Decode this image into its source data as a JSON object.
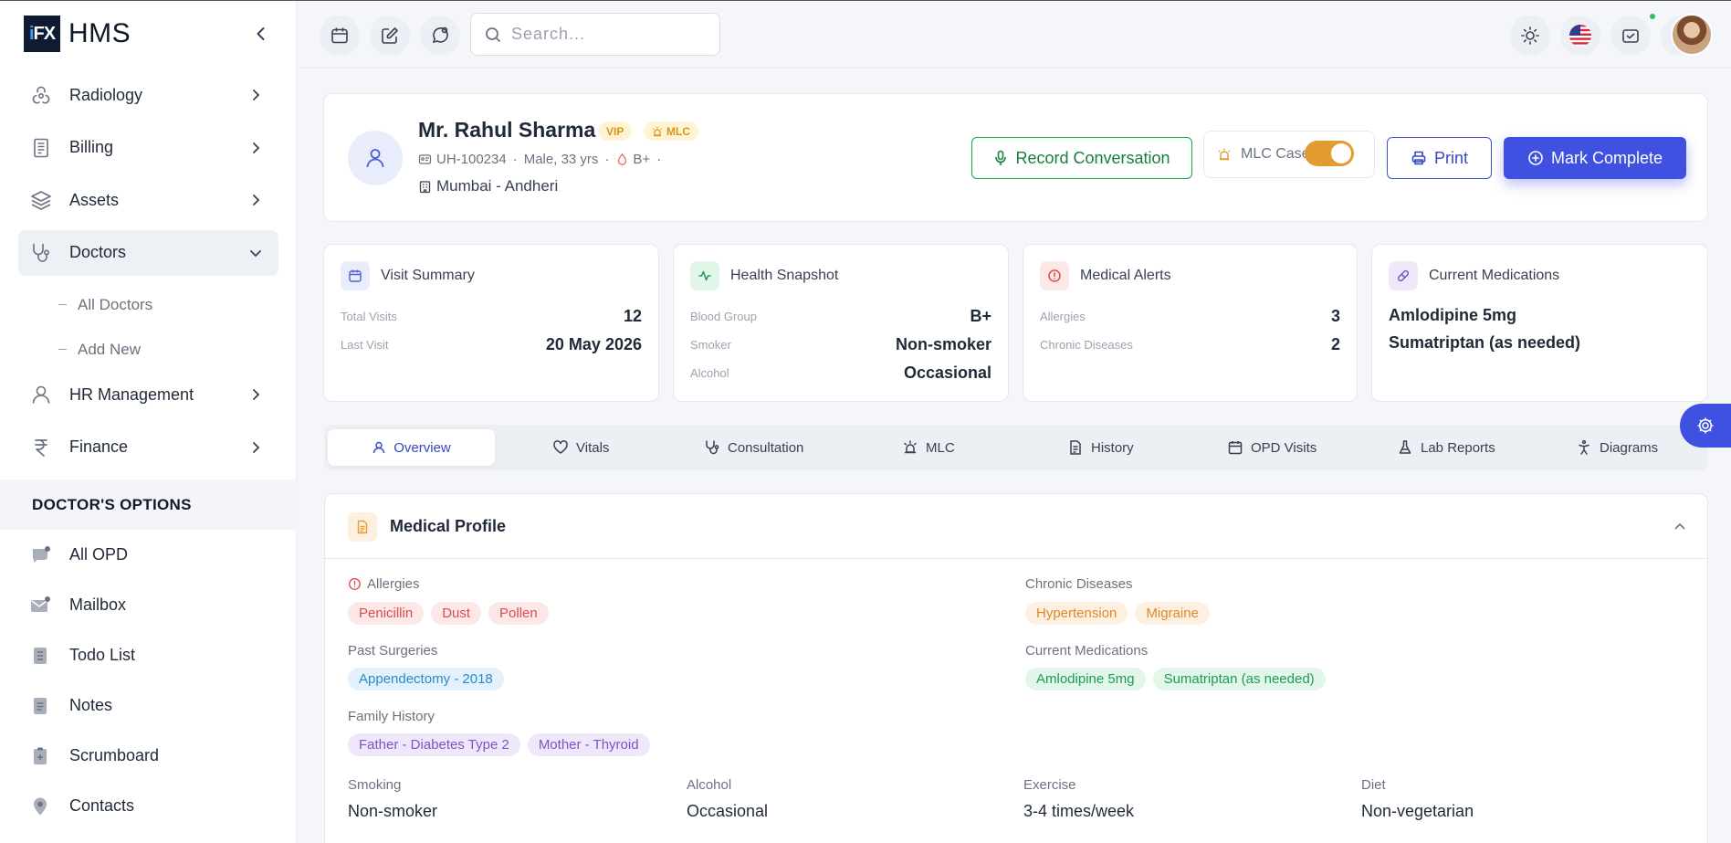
{
  "app": {
    "logo_mark": "iFX",
    "name": "HMS"
  },
  "sidebar": {
    "items": [
      {
        "label": "Radiology",
        "icon": "radiation-icon"
      },
      {
        "label": "Billing",
        "icon": "receipt-icon"
      },
      {
        "label": "Assets",
        "icon": "layers-icon"
      },
      {
        "label": "Doctors",
        "icon": "stethoscope-icon",
        "expanded": true,
        "children": [
          {
            "label": "All Doctors"
          },
          {
            "label": "Add New"
          }
        ]
      },
      {
        "label": "HR Management",
        "icon": "user-icon"
      },
      {
        "label": "Finance",
        "icon": "rupee-icon"
      }
    ],
    "section_title": "DOCTOR'S OPTIONS",
    "options": [
      {
        "label": "All OPD",
        "icon": "chat-icon"
      },
      {
        "label": "Mailbox",
        "icon": "mail-icon"
      },
      {
        "label": "Todo List",
        "icon": "todo-icon"
      },
      {
        "label": "Notes",
        "icon": "notes-icon"
      },
      {
        "label": "Scrumboard",
        "icon": "clipboard-icon"
      },
      {
        "label": "Contacts",
        "icon": "contact-icon"
      }
    ]
  },
  "topbar": {
    "search_placeholder": "Search..."
  },
  "patient": {
    "name": "Mr. Rahul Sharma",
    "badge_vip": "VIP",
    "badge_mlc": "MLC",
    "uhid": "UH-100234",
    "gender_age": "Male, 33 yrs",
    "blood_group": "B+",
    "location": "Mumbai - Andheri"
  },
  "actions": {
    "record": "Record Conversation",
    "mlc_case": "MLC Case",
    "mlc_case_on": true,
    "print": "Print",
    "complete": "Mark Complete"
  },
  "summary": {
    "visit": {
      "title": "Visit Summary",
      "rows": [
        {
          "k": "Total Visits",
          "v": "12"
        },
        {
          "k": "Last Visit",
          "v": "20 May 2026"
        }
      ]
    },
    "health": {
      "title": "Health Snapshot",
      "rows": [
        {
          "k": "Blood Group",
          "v": "B+"
        },
        {
          "k": "Smoker",
          "v": "Non-smoker"
        },
        {
          "k": "Alcohol",
          "v": "Occasional"
        }
      ]
    },
    "alerts": {
      "title": "Medical Alerts",
      "rows": [
        {
          "k": "Allergies",
          "v": "3"
        },
        {
          "k": "Chronic Diseases",
          "v": "2"
        }
      ]
    },
    "meds": {
      "title": "Current Medications",
      "items": [
        "Amlodipine 5mg",
        "Sumatriptan (as needed)"
      ]
    }
  },
  "tabs": [
    {
      "label": "Overview",
      "active": true
    },
    {
      "label": "Vitals"
    },
    {
      "label": "Consultation"
    },
    {
      "label": "MLC"
    },
    {
      "label": "History"
    },
    {
      "label": "OPD Visits"
    },
    {
      "label": "Lab Reports"
    },
    {
      "label": "Diagrams"
    }
  ],
  "profile": {
    "title": "Medical Profile",
    "allergies_label": "Allergies",
    "allergies": [
      "Penicillin",
      "Dust",
      "Pollen"
    ],
    "chronic_label": "Chronic Diseases",
    "chronic": [
      "Hypertension",
      "Migraine"
    ],
    "surgeries_label": "Past Surgeries",
    "surgeries": [
      "Appendectomy - 2018"
    ],
    "medications_label": "Current Medications",
    "medications": [
      "Amlodipine 5mg",
      "Sumatriptan (as needed)"
    ],
    "family_label": "Family History",
    "family": [
      "Father - Diabetes Type 2",
      "Mother - Thyroid"
    ],
    "habits": [
      {
        "k": "Smoking",
        "v": "Non-smoker"
      },
      {
        "k": "Alcohol",
        "v": "Occasional"
      },
      {
        "k": "Exercise",
        "v": "3-4 times/week"
      },
      {
        "k": "Diet",
        "v": "Non-vegetarian"
      }
    ]
  }
}
